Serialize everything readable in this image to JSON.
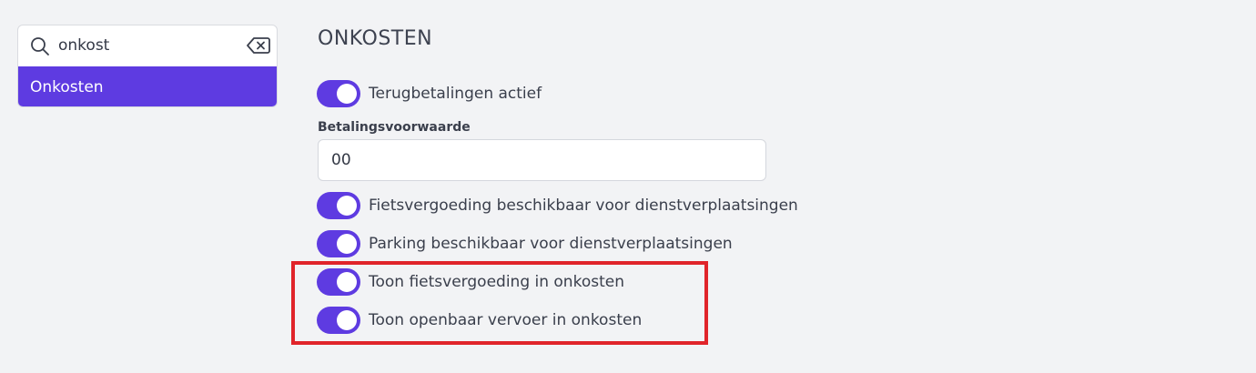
{
  "sidebar": {
    "search": {
      "value": "onkost",
      "placeholder": ""
    },
    "results": [
      {
        "label": "Onkosten",
        "selected": true
      }
    ]
  },
  "main": {
    "section_title": "ONKOSTEN",
    "toggles": {
      "refunds_active": {
        "label": "Terugbetalingen actief",
        "on": true
      },
      "bike_allowance": {
        "label": "Fietsvergoeding beschikbaar voor dienstverplaatsingen",
        "on": true
      },
      "parking": {
        "label": "Parking beschikbaar voor dienstverplaatsingen",
        "on": true
      },
      "show_bike_allowance": {
        "label": "Toon fietsvergoeding in onkosten",
        "on": true
      },
      "show_public_transport": {
        "label": "Toon openbaar vervoer in onkosten",
        "on": true
      }
    },
    "payment_term": {
      "label": "Betalingsvoorwaarde",
      "value": "00"
    }
  },
  "colors": {
    "accent": "#5e3be1",
    "highlight": "#e0242a",
    "background": "#f2f3f5"
  },
  "icons": {
    "search": "search-icon",
    "clear": "backspace-clear-icon"
  }
}
